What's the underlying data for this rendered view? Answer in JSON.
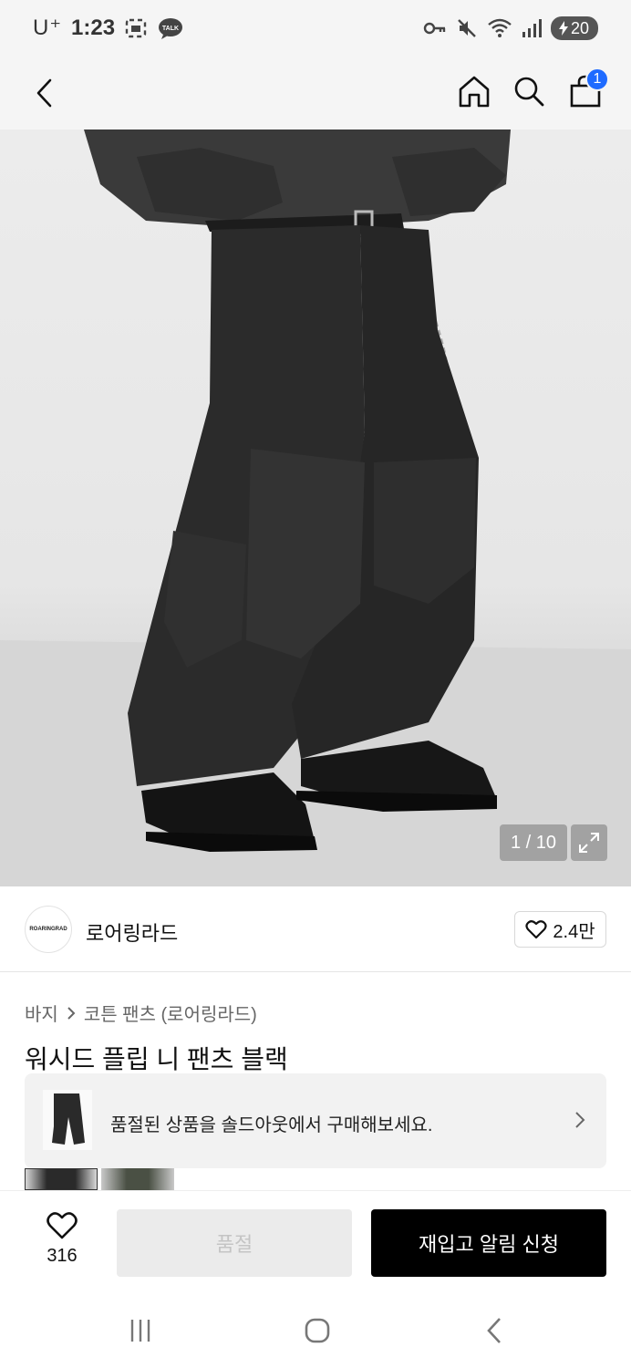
{
  "status_bar": {
    "carrier": "U⁺",
    "time": "1:23",
    "notification_icons": [
      "screenshot-icon",
      "kakaotalk-icon"
    ],
    "system_icons": [
      "key-icon",
      "mute-icon",
      "wifi-icon",
      "signal-icon"
    ],
    "battery": "20",
    "kakao_label": "TALK"
  },
  "header": {
    "cart_count": "1"
  },
  "gallery": {
    "counter": "1 / 10"
  },
  "brand": {
    "logo_text": "ROARINGRAD",
    "name": "로어링라드",
    "likes": "2.4만"
  },
  "breadcrumb": {
    "category": "바지",
    "subcategory": "코튼 팬츠 (로어링라드)"
  },
  "product": {
    "title": "워시드 플립 니 팬츠 블랙"
  },
  "soldout_banner": {
    "text": "품절된 상품을 솔드아웃에서 구매해보세요."
  },
  "action_bar": {
    "wish_count": "316",
    "soldout_label": "품절",
    "restock_label": "재입고 알림 신청"
  },
  "colors": {
    "badge_blue": "#1f6bff",
    "primary_button": "#000000",
    "disabled_button": "#ebebeb"
  }
}
